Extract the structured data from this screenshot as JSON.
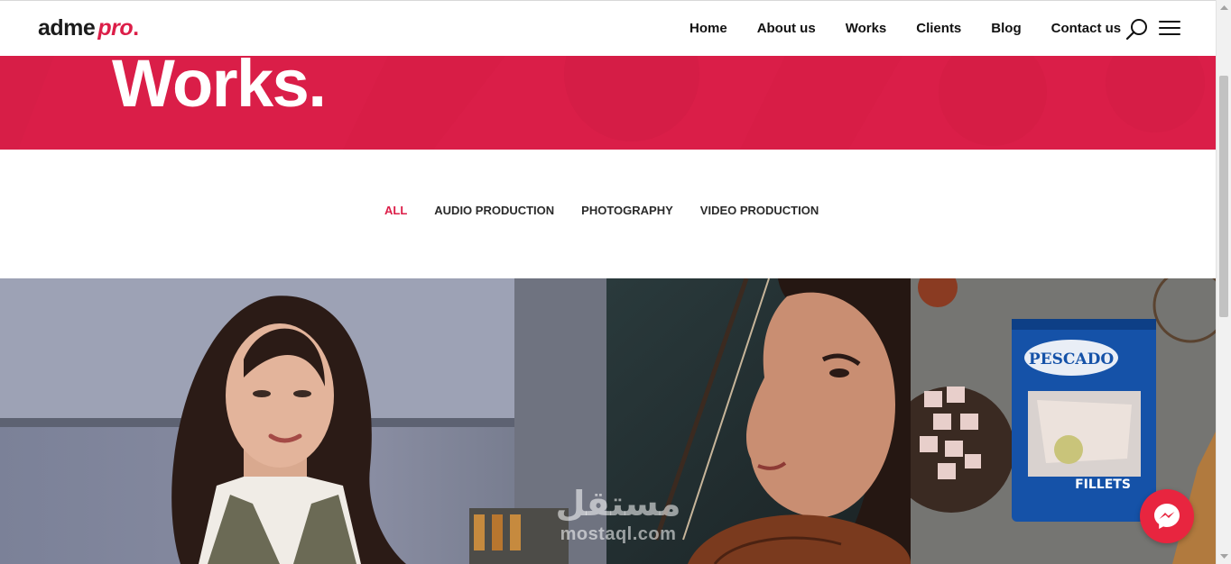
{
  "logo": {
    "part1": "adme",
    "part2": "pro",
    "dot": "."
  },
  "nav": {
    "items": [
      {
        "label": "Home"
      },
      {
        "label": "About us"
      },
      {
        "label": "Works"
      },
      {
        "label": "Clients"
      },
      {
        "label": "Blog"
      },
      {
        "label": "Contact us"
      }
    ],
    "search_icon": "search-icon",
    "menu_icon": "hamburger-menu-icon"
  },
  "hero": {
    "title": "Works."
  },
  "filters": {
    "items": [
      {
        "label": "ALL",
        "active": true
      },
      {
        "label": "AUDIO PRODUCTION",
        "active": false
      },
      {
        "label": "PHOTOGRAPHY",
        "active": false
      },
      {
        "label": "VIDEO PRODUCTION",
        "active": false
      }
    ]
  },
  "gallery": {
    "items": [
      {
        "subject": "woman-in-kitchen-photo"
      },
      {
        "subject": "violinist-photo"
      },
      {
        "subject": "fish-fillets-package-photo",
        "package_label": "PESCADO",
        "package_text": "FILLETS"
      }
    ]
  },
  "watermark": {
    "arabic": "مستقل",
    "latin": "mostaql.com"
  },
  "messenger": {
    "icon": "messenger-icon"
  },
  "colors": {
    "accent": "#da1e48",
    "text": "#111111"
  }
}
